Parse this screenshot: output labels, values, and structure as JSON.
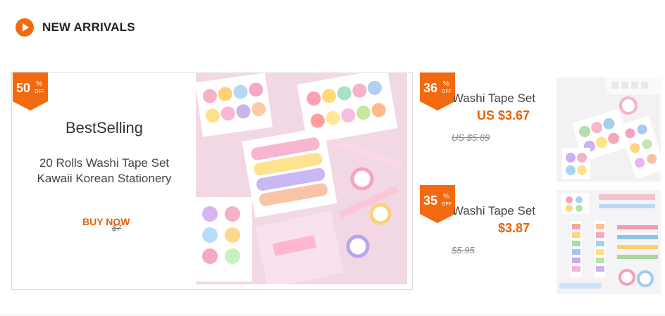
{
  "section": {
    "title": "NEW ARRIVALS",
    "icon": "play-circle-icon",
    "accent": "#f26a10"
  },
  "featured": {
    "badge": {
      "value": "50",
      "percent": "%",
      "off": "OFF"
    },
    "title": "BestSelling",
    "description_line1": "20 Rolls Washi Tape Set",
    "description_line2": "Kawaii Korean Stationery",
    "cta": "BUY NOW",
    "old_price": "$7",
    "image": "washi-tape-boxes-image"
  },
  "items": [
    {
      "badge": {
        "value": "36",
        "percent": "%",
        "off": "OFF"
      },
      "name": "Washi Tape Set",
      "price": "US $3.67",
      "old_price": "US $5.69",
      "image": "washi-tape-rolls-image"
    },
    {
      "badge": {
        "value": "35",
        "percent": "%",
        "off": "OFF"
      },
      "name": "Washi Tape Set",
      "price": "$3.87",
      "old_price": "$5.95",
      "image": "washi-tape-colorful-image"
    }
  ],
  "colors": {
    "accent": "#f26a10",
    "price": "#e8620a"
  }
}
